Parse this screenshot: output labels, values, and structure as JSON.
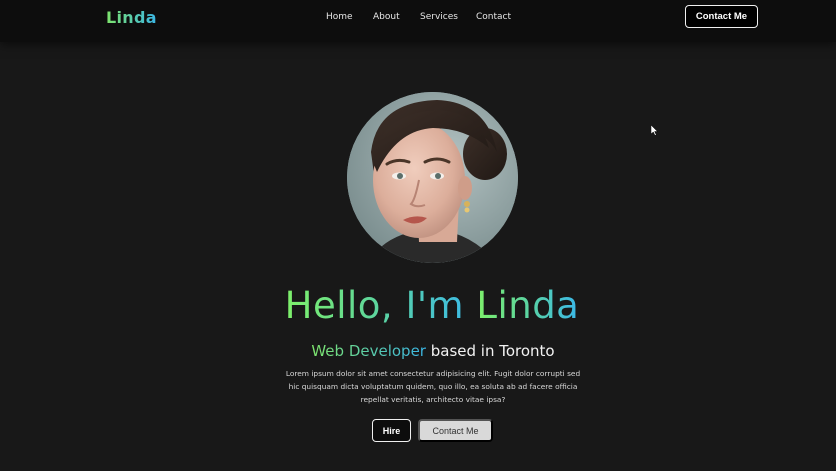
{
  "nav": {
    "logo": "Linda",
    "links": [
      "Home",
      "About",
      "Services",
      "Contact"
    ],
    "cta": "Contact Me"
  },
  "hero": {
    "greeting": "Hello, I'm ",
    "name": "Linda",
    "role": "Web Developer",
    "location_text": " based in Toronto",
    "description": "Lorem ipsum dolor sit amet consectetur adipisicing elit. Fugit dolor corrupti sed hic quisquam dicta voluptatum quidem, quo illo, ea soluta ab ad facere officia repellat veritatis, architecto vitae ipsa?",
    "hire_label": "Hire",
    "contact_label": "Contact Me"
  },
  "icons": {
    "cursor": "mouse-pointer-icon"
  },
  "colors": {
    "background": "#181818",
    "navbar": "#0d0d0d",
    "gradient_start": "#7ee46b",
    "gradient_end": "#3ab6e6"
  }
}
